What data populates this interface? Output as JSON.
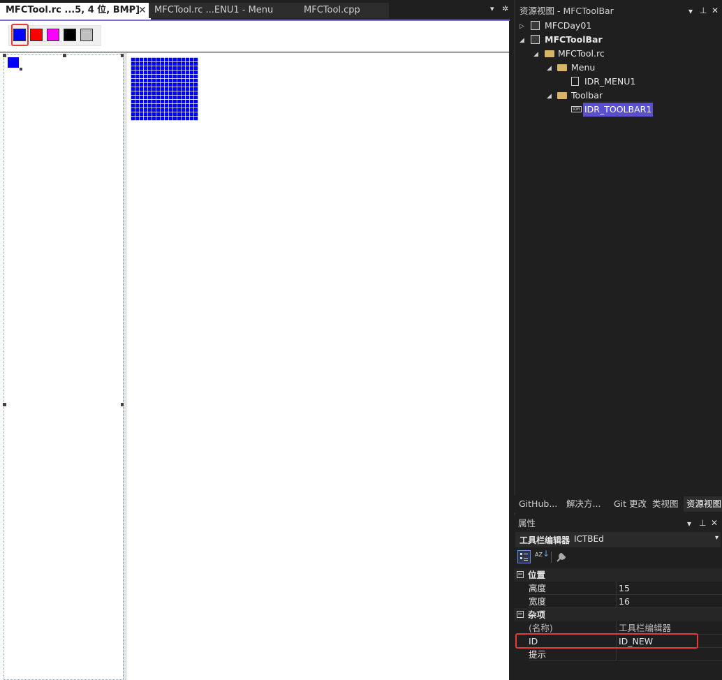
{
  "tabs": [
    {
      "label": "MFCTool.rc ...5, 4 位, BMP]",
      "active": true
    },
    {
      "label": "MFCTool.rc ...ENU1 - Menu",
      "active": false
    },
    {
      "label": "MFCTool.cpp",
      "active": false
    }
  ],
  "tab_controls": {
    "pin": "⊣",
    "close": "✕",
    "dropdown": "▾",
    "settings": "✲"
  },
  "toolbar_buttons": [
    {
      "name": "blue",
      "color": "#0000ff",
      "selected": true
    },
    {
      "name": "red",
      "color": "#ff0000",
      "selected": false
    },
    {
      "name": "magenta",
      "color": "#ff00ff",
      "selected": false
    },
    {
      "name": "black",
      "color": "#000000",
      "selected": false
    },
    {
      "name": "gray",
      "color": "#c0c0c0",
      "selected": false
    }
  ],
  "editor": {
    "image_color": "#0000ff",
    "highlight_color": "#e83a3a"
  },
  "resource_view": {
    "title": "资源视图 - MFCToolBar",
    "controls": {
      "dropdown": "▾",
      "pin": "⊥",
      "close": "✕"
    },
    "tree": [
      {
        "label": "MFCDay01",
        "expanded": false,
        "icon": "rc-project-icon"
      },
      {
        "label": "MFCToolBar",
        "expanded": true,
        "bold": true,
        "icon": "rc-project-icon"
      },
      {
        "label": "MFCTool.rc",
        "expanded": true,
        "icon": "folder-open-icon"
      },
      {
        "label": "Menu",
        "expanded": true,
        "icon": "folder-open-icon"
      },
      {
        "label": "IDR_MENU1",
        "icon": "menu-resource-icon"
      },
      {
        "label": "Toolbar",
        "expanded": true,
        "icon": "folder-open-icon"
      },
      {
        "label": "IDR_TOOLBAR1",
        "selected": true,
        "icon": "toolbar-resource-icon",
        "icon_text": "IDR"
      }
    ]
  },
  "bottom_tabs": [
    "GitHub...",
    "解决方...",
    "Git 更改",
    "类视图",
    "资源视图"
  ],
  "properties": {
    "title": "属性",
    "controls": {
      "dropdown": "▾",
      "pin": "⊥",
      "close": "✕"
    },
    "object_name": "工具栏编辑器",
    "object_type": "ICTBEd",
    "object_dropdown": "▾",
    "categories": [
      {
        "name": "位置",
        "toggle": "⊟",
        "rows": [
          {
            "key": "高度",
            "value": "15"
          },
          {
            "key": "宽度",
            "value": "16"
          }
        ]
      },
      {
        "name": "杂项",
        "toggle": "⊟",
        "rows": [
          {
            "key": "(名称)",
            "value": "工具栏编辑器"
          },
          {
            "key": "ID",
            "value": "ID_NEW"
          },
          {
            "key": "提示",
            "value": ""
          }
        ]
      }
    ],
    "toolbar_icons": [
      "categorized-icon",
      "alphabetical-icon",
      "property-pages-icon"
    ],
    "alpha_sort_text": "AZ"
  }
}
